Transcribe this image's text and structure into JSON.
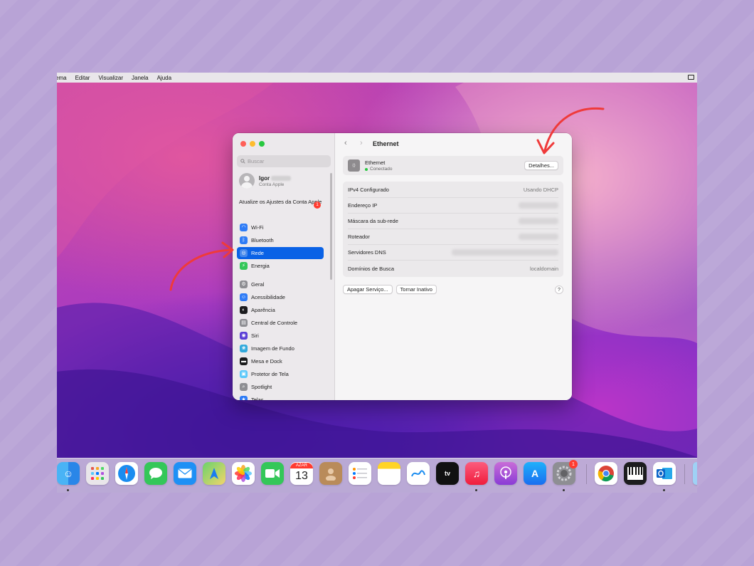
{
  "menubar": {
    "items": [
      "ema",
      "Editar",
      "Visualizar",
      "Janela",
      "Ajuda"
    ]
  },
  "window": {
    "title": "Ethernet",
    "sidebar": {
      "search_placeholder": "Buscar",
      "user": {
        "name": "Igor",
        "subtitle": "Conta Apple"
      },
      "update_notice": "Atualize os Ajustes da Conta Apple",
      "update_badge": "1",
      "items": [
        {
          "label": "Wi-Fi",
          "icon": "wifi-icon",
          "color": "#2f7cf6"
        },
        {
          "label": "Bluetooth",
          "icon": "bluetooth-icon",
          "color": "#2f7cf6"
        },
        {
          "label": "Rede",
          "icon": "globe-icon",
          "color": "#2f7cf6",
          "active": true
        },
        {
          "label": "Energia",
          "icon": "bolt-icon",
          "color": "#34c759"
        },
        {
          "label": "Geral",
          "icon": "gear-icon",
          "color": "#8e8e93"
        },
        {
          "label": "Acessibilidade",
          "icon": "accessibility-icon",
          "color": "#2f7cf6"
        },
        {
          "label": "Aparência",
          "icon": "appearance-icon",
          "color": "#1c1c1e"
        },
        {
          "label": "Central de Controle",
          "icon": "control-center-icon",
          "color": "#8e8e93"
        },
        {
          "label": "Siri",
          "icon": "siri-icon",
          "color": "#5b3fd6"
        },
        {
          "label": "Imagem de Fundo",
          "icon": "wallpaper-icon",
          "color": "#34aadc"
        },
        {
          "label": "Mesa e Dock",
          "icon": "dock-icon",
          "color": "#1c1c1e"
        },
        {
          "label": "Protetor de Tela",
          "icon": "screensaver-icon",
          "color": "#5ac8fa"
        },
        {
          "label": "Spotlight",
          "icon": "spotlight-icon",
          "color": "#8e8e93"
        },
        {
          "label": "Telas",
          "icon": "display-icon",
          "color": "#2f7cf6"
        }
      ]
    },
    "ethernet": {
      "name": "Ethernet",
      "status": "Conectado",
      "details_button": "Detalhes..."
    },
    "info_rows": [
      {
        "label": "IPv4 Configurado",
        "value": "Usando DHCP"
      },
      {
        "label": "Endereço IP",
        "value": ""
      },
      {
        "label": "Máscara da sub-rede",
        "value": ""
      },
      {
        "label": "Roteador",
        "value": ""
      },
      {
        "label": "Servidores DNS",
        "value": ""
      },
      {
        "label": "Domínios de Busca",
        "value": "localdomain"
      }
    ],
    "buttons": {
      "delete_service": "Apagar Serviço...",
      "make_inactive": "Tornar Inativo",
      "help": "?"
    }
  },
  "dock": {
    "calendar_month": "AZAR",
    "calendar_day": "13",
    "settings_badge": "1"
  },
  "colors": {
    "accent": "#0a62e6",
    "annotation_arrow": "#ef3a3a"
  }
}
